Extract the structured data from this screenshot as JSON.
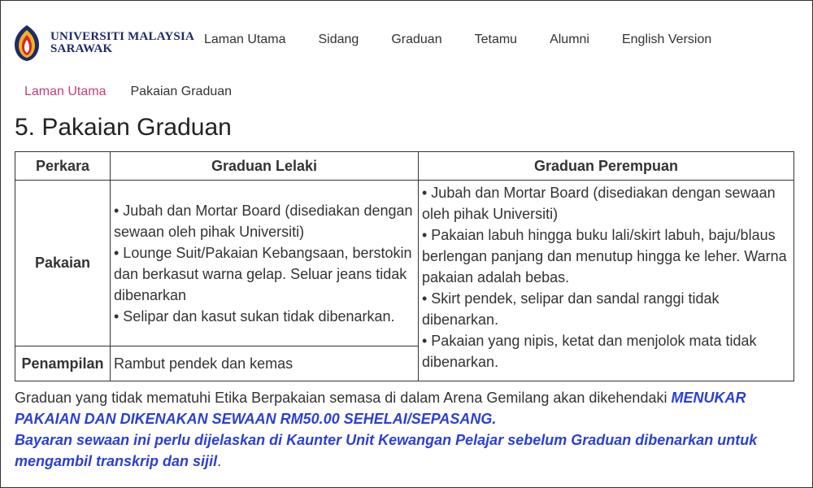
{
  "brand": {
    "line1": "UNIVERSITI MALAYSIA",
    "line2": "SARAWAK"
  },
  "nav": [
    {
      "label": "Laman Utama"
    },
    {
      "label": "Sidang"
    },
    {
      "label": "Graduan"
    },
    {
      "label": "Tetamu"
    },
    {
      "label": "Alumni"
    },
    {
      "label": "English Version"
    }
  ],
  "breadcrumb": {
    "home": "Laman Utama",
    "current": "Pakaian Graduan"
  },
  "page_title": "5. Pakaian Graduan",
  "table": {
    "headers": [
      "Perkara",
      "Graduan Lelaki",
      "Graduan Perempuan"
    ],
    "rows": [
      {
        "item": "Pakaian",
        "male": [
          "• Jubah dan Mortar Board (disediakan dengan sewaan oleh pihak Universiti)",
          "• Lounge Suit/Pakaian Kebangsaan, berstokin dan berkasut warna gelap. Seluar jeans tidak dibenarkan",
          "• Selipar dan kasut sukan tidak dibenarkan."
        ]
      },
      {
        "item": "Penampilan",
        "male": [
          "Rambut pendek dan kemas"
        ]
      }
    ],
    "female": [
      "• Jubah dan Mortar Board (disediakan dengan sewaan oleh pihak Universiti)",
      "• Pakaian labuh hingga buku lali/skirt labuh, baju/blaus berlengan panjang dan menutup hingga ke leher. Warna pakaian adalah bebas.",
      "• Skirt pendek, selipar dan sandal ranggi tidak dibenarkan.",
      "• Pakaian yang nipis, ketat dan menjolok mata tidak dibenarkan."
    ]
  },
  "notice": {
    "plain": "Graduan yang tidak mematuhi Etika Berpakaian semasa di dalam Arena Gemilang akan dikehendaki ",
    "emph1": "MENUKAR PAKAIAN DAN DIKENAKAN SEWAAN RM50.00 SEHELAI/SEPASANG.",
    "emph2": "Bayaran sewaan ini perlu dijelaskan di Kaunter Unit Kewangan Pelajar sebelum Graduan dibenarkan untuk mengambil transkrip dan sijil",
    "end": "."
  },
  "colors": {
    "brand_navy": "#1d2a6b",
    "link_pink": "#c2407b",
    "emphasis_blue": "#2b3fd6"
  }
}
